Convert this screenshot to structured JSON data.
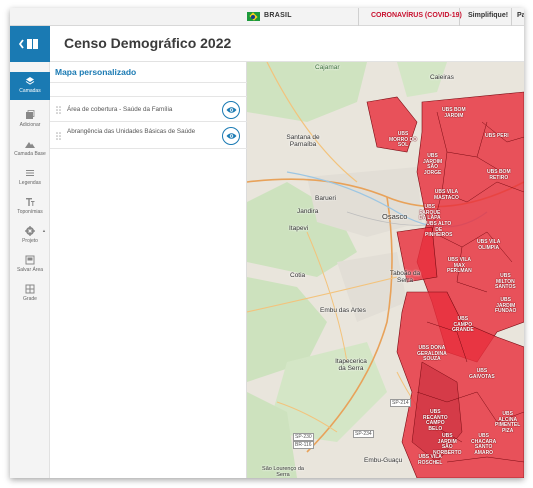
{
  "govbar": {
    "country": "BRASIL",
    "covid_link": "CORONAVÍRUS (COVID-19)",
    "simplifique": "Simplifique!",
    "participe": "Pa"
  },
  "header": {
    "title": "Censo Demográfico 2022"
  },
  "rail": {
    "items": [
      {
        "label": "Camadas",
        "icon": "layers-icon"
      },
      {
        "label": "Adicionar",
        "icon": "add-layer-icon"
      },
      {
        "label": "Camada Base",
        "icon": "basemap-icon"
      },
      {
        "label": "Legendas",
        "icon": "legend-icon"
      },
      {
        "label": "Toponímias",
        "icon": "text-icon"
      },
      {
        "label": "Projeto",
        "icon": "gear-icon"
      },
      {
        "label": "Salvar Área",
        "icon": "save-area-icon"
      },
      {
        "label": "Grade",
        "icon": "grid-icon"
      }
    ]
  },
  "panel": {
    "title": "Mapa personalizado",
    "layers": [
      {
        "label": "Área de cobertura - Saúde da Família"
      },
      {
        "label": "Abrangência das Unidades Básicas de Saúde"
      }
    ]
  },
  "map": {
    "places": [
      "Cajamar",
      "Caieiras",
      "Santana de Parnaíba",
      "Barueri",
      "Jandira",
      "Itapevi",
      "Osasco",
      "Cotia",
      "Taboão da Serra",
      "Embu das Artes",
      "Itapecerica da Serra",
      "Embu-Guaçu",
      "São Lourenço da Serra"
    ],
    "roads": [
      "SP-214",
      "SP-234",
      "SP-230",
      "BR-116"
    ],
    "ubs_labels": [
      "UBS BOM JARDIM",
      "UBS MORRO DO SOL",
      "UBS JARDIM SÃO JORGE",
      "UBS PERI",
      "UBS BOM RETIRO",
      "UBS VILA MASTACO",
      "UBS PARQUE DA LAPA",
      "UBS ALTO DE PINHEIROS",
      "UBS VILA OLIMPIA",
      "UBS VILA MAX PERLMAN",
      "UBS MILTON SANTOS",
      "UBS JARDIM FUNDAO",
      "UBS CAMPO GRANDE",
      "UBS DONA GERALDINA SOUZA",
      "UBS GAIVOTAS",
      "UBS RECANTO CAMPO BELO",
      "UBS JARDIM SÃO NORBERTO",
      "UBS CHACARA SANTO AMARO",
      "UBS ALCINA PIMENTEL PIZA",
      "UBS VILA ROSCHEL"
    ],
    "colors": {
      "coverage_fill": "#e8303d",
      "coverage_border": "#7a0a12",
      "vegetation": "#cfe3c0",
      "urban": "#ece7de",
      "accent": "#1a7ab3"
    }
  }
}
